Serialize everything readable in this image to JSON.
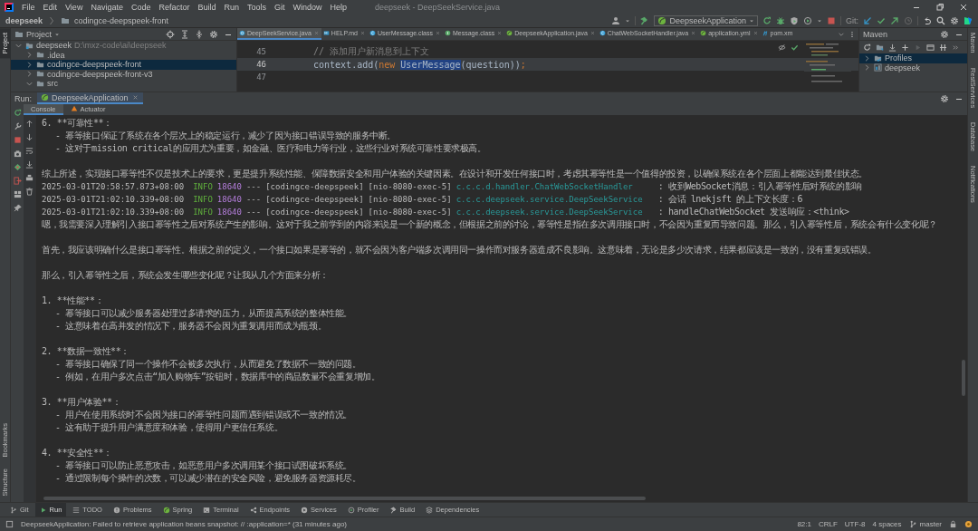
{
  "menu_bar": {
    "items": [
      "File",
      "Edit",
      "View",
      "Navigate",
      "Code",
      "Refactor",
      "Build",
      "Run",
      "Tools",
      "Git",
      "Window",
      "Help"
    ],
    "window_title": "deepseek - DeepSeekService.java"
  },
  "navigation_bar": {
    "breadcrumbs": [
      "deepseek",
      "codingce-deepspeek-front"
    ],
    "run_configuration": "DeepseekApplication",
    "git_label": "Git:"
  },
  "left_tool_strip": {
    "top": [
      {
        "label": "Project",
        "selected": true
      }
    ],
    "bottom": [
      {
        "label": "Bookmarks",
        "selected": false
      },
      {
        "label": "Structure",
        "selected": false
      }
    ]
  },
  "project_panel": {
    "title": "Project",
    "tree": [
      {
        "label": "deepseek",
        "path": "D:\\mxz-code\\ai\\deepseek",
        "expanded": true,
        "selected": false,
        "children": [
          {
            "label": ".idea",
            "expanded": false,
            "selected": false
          },
          {
            "label": "codingce-deepspeek-front",
            "expanded": false,
            "selected": true
          },
          {
            "label": "codingce-deepspeek-front-v3",
            "expanded": false,
            "selected": false
          },
          {
            "label": "src",
            "expanded": true,
            "selected": false
          }
        ]
      }
    ]
  },
  "editor": {
    "tabs": [
      {
        "label": "DeepSeekService.java",
        "kind": "class",
        "selected": true,
        "closable": true
      },
      {
        "label": "HELP.md",
        "kind": "markdown",
        "selected": false,
        "closable": true
      },
      {
        "label": "UserMessage.class",
        "kind": "class-file",
        "selected": false,
        "closable": true
      },
      {
        "label": "Message.class",
        "kind": "interface",
        "selected": false,
        "closable": true
      },
      {
        "label": "DeepseekApplication.java",
        "kind": "spring",
        "selected": false,
        "closable": true
      },
      {
        "label": "ChatWebSocketHandler.java",
        "kind": "class-file",
        "selected": false,
        "closable": true
      },
      {
        "label": "application.yml",
        "kind": "spring",
        "selected": false,
        "closable": true
      },
      {
        "label": "pom.xm",
        "kind": "maven",
        "selected": false,
        "closable": false
      }
    ],
    "lines": [
      {
        "number": "45",
        "current": false,
        "tokens": [
          {
            "kind": "comment",
            "text": "// 添加用户新消息到上下文"
          }
        ]
      },
      {
        "number": "46",
        "current": true,
        "tokens": [
          {
            "kind": "plain",
            "text": "context.add("
          },
          {
            "kind": "keyword",
            "text": "new "
          },
          {
            "kind": "highlight",
            "text": "UserMessage"
          },
          {
            "kind": "plain",
            "text": "(question))"
          },
          {
            "kind": "keyword",
            "text": ";"
          }
        ]
      },
      {
        "number": "47",
        "current": false
      }
    ]
  },
  "maven_panel": {
    "title": "Maven",
    "tree": [
      {
        "label": "Profiles",
        "expanded": false,
        "selected": true
      },
      {
        "label": "deepseek",
        "expanded": false,
        "selected": false
      }
    ]
  },
  "right_tool_strip": [
    {
      "label": "Maven",
      "selected": false
    },
    {
      "label": "RestServices",
      "selected": false
    },
    {
      "label": "Database",
      "selected": false
    },
    {
      "label": "Notifications",
      "selected": false
    }
  ],
  "run_panel": {
    "label": "Run:",
    "tabs": [
      {
        "label": "DeepseekApplication",
        "selected": true
      }
    ],
    "console_tabs": [
      {
        "label": "Console",
        "selected": true
      },
      {
        "label": "Actuator",
        "selected": false
      }
    ],
    "lines": [
      {
        "kind": "item",
        "text": "6. **可靠性**："
      },
      {
        "kind": "sub",
        "text": "- 幂等接口保证了系统在各个层次上的稳定运行，减少了因为接口错误导致的服务中断。"
      },
      {
        "kind": "sub",
        "text": "- 这对于mission critical的应用尤为重要，如金融、医疗和电力等行业，这些行业对系统可靠性要求极高。"
      },
      {
        "kind": "blank"
      },
      {
        "kind": "text",
        "text": "综上所述，实现接口幂等性不仅是技术上的要求，更是提升系统性能、保障数据安全和用户体验的关键因素。在设计和开发任何接口时，考虑其幂等性是一个值得的投资，以确保系统在各个层面上都能达到最佳状态。"
      },
      {
        "kind": "log",
        "timestamp": "2025-03-01T20:58:57.873+08:00",
        "level": "INFO",
        "pid": "18640",
        "separator": "---",
        "app": "[codingce-deepspeek]",
        "thread": "[nio-8080-exec-5]",
        "logger": "c.c.c.d.handler.ChatWebSocketHandler",
        "message": ": 收到WebSocket消息：引入幂等性后对系统的影响"
      },
      {
        "kind": "log",
        "timestamp": "2025-03-01T21:02:10.339+08:00",
        "level": "INFO",
        "pid": "18640",
        "separator": "---",
        "app": "[codingce-deepspeek]",
        "thread": "[nio-8080-exec-5]",
        "logger": "c.c.c.deepseek.service.DeepSeekService",
        "message": ": 会话 lnekjsft 的上下文长度：6"
      },
      {
        "kind": "log",
        "timestamp": "2025-03-01T21:02:10.339+08:00",
        "level": "INFO",
        "pid": "18640",
        "separator": "---",
        "app": "[codingce-deepspeek]",
        "thread": "[nio-8080-exec-5]",
        "logger": "c.c.c.deepseek.service.DeepSeekService",
        "message": ": handleChatWebSocket 发送响应：<think>"
      },
      {
        "kind": "text",
        "text": "嗯，我需要深入理解引入接口幂等性之后对系统产生的影响。这对于我之前学到的内容来说是一个新的概念，但根据之前的讨论，幂等性是指在多次调用接口时，不会因为重复而导致问题。那么，引入幂等性后，系统会有什么变化呢？"
      },
      {
        "kind": "blank"
      },
      {
        "kind": "text",
        "text": "首先，我应该明确什么是接口幂等性。根据之前的定义，一个接口如果是幂等的，就不会因为客户端多次调用同一操作而对服务器造成不良影响。这意味着，无论是多少次请求，结果都应该是一致的，没有重复或错误。"
      },
      {
        "kind": "blank"
      },
      {
        "kind": "text",
        "text": "那么，引入幂等性之后，系统会发生哪些变化呢？让我从几个方面来分析："
      },
      {
        "kind": "blank"
      },
      {
        "kind": "item",
        "text": "1. **性能**："
      },
      {
        "kind": "sub",
        "text": "- 幂等接口可以减少服务器处理过多请求的压力，从而提高系统的整体性能。"
      },
      {
        "kind": "sub",
        "text": "- 这意味着在高并发的情况下，服务器不会因为重复调用而成为瓶颈。"
      },
      {
        "kind": "blank"
      },
      {
        "kind": "item",
        "text": "2. **数据一致性**："
      },
      {
        "kind": "sub",
        "text": "- 幂等接口确保了同一个操作不会被多次执行，从而避免了数据不一致的问题。"
      },
      {
        "kind": "sub",
        "text": "- 例如，在用户多次点击“加入购物车”按钮时，数据库中的商品数量不会重复增加。"
      },
      {
        "kind": "blank"
      },
      {
        "kind": "item",
        "text": "3. **用户体验**："
      },
      {
        "kind": "sub",
        "text": "- 用户在使用系统时不会因为接口的幂等性问题而遇到错误或不一致的情况。"
      },
      {
        "kind": "sub",
        "text": "- 这有助于提升用户满意度和体验，使得用户更信任系统。"
      },
      {
        "kind": "blank"
      },
      {
        "kind": "item",
        "text": "4. **安全性**："
      },
      {
        "kind": "sub",
        "text": "- 幂等接口可以防止恶意攻击，如恶意用户多次调用某个接口试图破坏系统。"
      },
      {
        "kind": "sub",
        "text": "- 通过限制每个操作的次数，可以减少潜在的安全风险，避免服务器资源耗尽。"
      }
    ]
  },
  "bottom_tool_bar": [
    {
      "label": "Git",
      "selected": false
    },
    {
      "label": "Run",
      "selected": true
    },
    {
      "label": "TODO",
      "selected": false
    },
    {
      "label": "Problems",
      "selected": false
    },
    {
      "label": "Spring",
      "selected": false
    },
    {
      "label": "Terminal",
      "selected": false
    },
    {
      "label": "Endpoints",
      "selected": false
    },
    {
      "label": "Services",
      "selected": false
    },
    {
      "label": "Profiler",
      "selected": false
    },
    {
      "label": "Build",
      "selected": false
    },
    {
      "label": "Dependencies",
      "selected": false
    }
  ],
  "status_bar": {
    "message": "DeepseekApplication: Failed to retrieve application beans snapshot: // :application=* (31 minutes ago)",
    "position": "82:1",
    "line_separator": "CRLF",
    "encoding": "UTF-8",
    "indent": "4 spaces",
    "branch": "master"
  }
}
